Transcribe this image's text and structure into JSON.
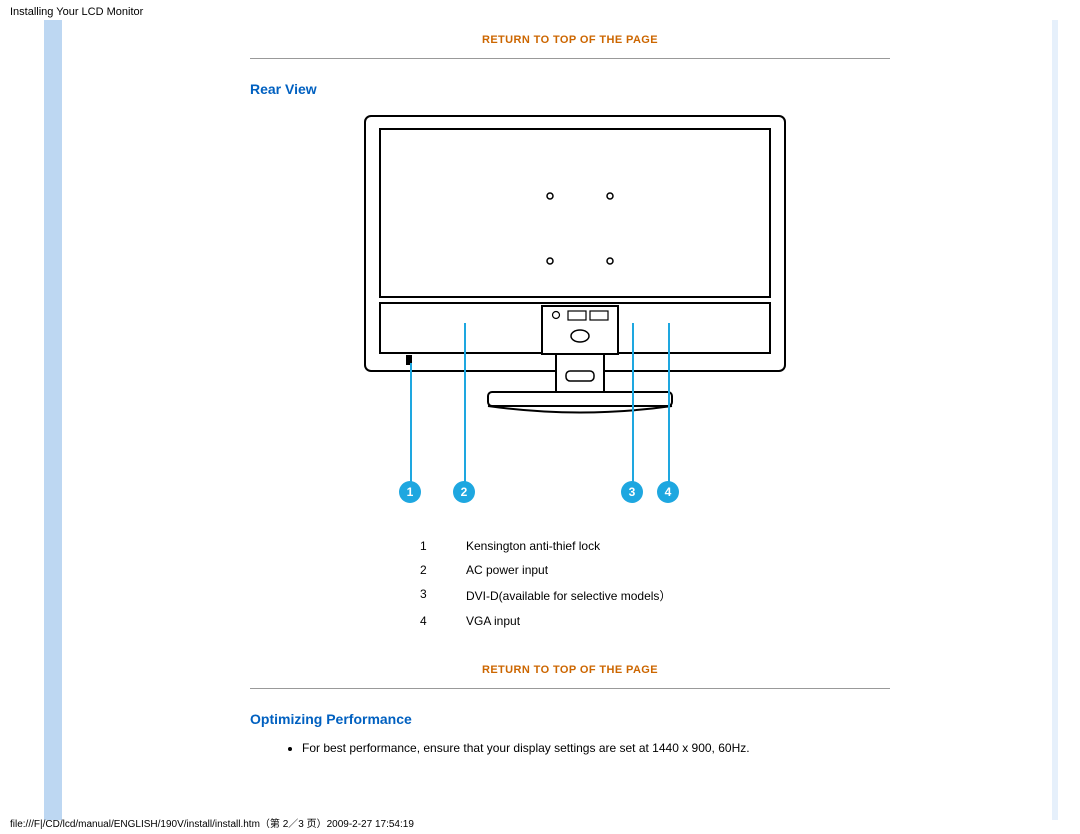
{
  "header": {
    "title": "Installing Your LCD Monitor"
  },
  "links": {
    "return_top_1": "RETURN TO TOP OF THE PAGE",
    "return_top_2": "RETURN TO TOP OF THE PAGE"
  },
  "sections": {
    "rear_view": {
      "title": "Rear View"
    },
    "optimizing": {
      "title": "Optimizing Performance",
      "bullet": "For best performance, ensure that your display settings are set at 1440 x 900, 60Hz."
    }
  },
  "callouts": {
    "labels": {
      "c1": "1",
      "c2": "2",
      "c3": "3",
      "c4": "4"
    }
  },
  "legend": {
    "r1": {
      "num": "1",
      "text": "Kensington anti-thief lock"
    },
    "r2": {
      "num": "2",
      "text": "AC power input"
    },
    "r3": {
      "num": "3",
      "text": "DVI-D(available for selective models）"
    },
    "r4": {
      "num": "4",
      "text": "VGA input"
    }
  },
  "footer": {
    "path": "file:///F|/CD/lcd/manual/ENGLISH/190V/install/install.htm（第 2／3 页）2009-2-27 17:54:19"
  }
}
